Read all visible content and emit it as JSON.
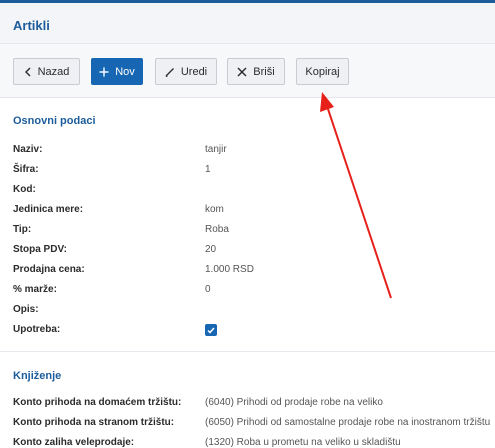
{
  "header": {
    "title": "Artikli"
  },
  "toolbar": {
    "back_label": "Nazad",
    "new_label": "Nov",
    "edit_label": "Uredi",
    "delete_label": "Briši",
    "copy_label": "Kopiraj"
  },
  "basic": {
    "title": "Osnovni podaci",
    "rows": [
      {
        "label": "Naziv:",
        "value": "tanjir"
      },
      {
        "label": "Šifra:",
        "value": "1"
      },
      {
        "label": "Kod:",
        "value": ""
      },
      {
        "label": "Jedinica mere:",
        "value": "kom"
      },
      {
        "label": "Tip:",
        "value": "Roba"
      },
      {
        "label": "Stopa PDV:",
        "value": "20"
      },
      {
        "label": "Prodajna cena:",
        "value": "1.000 RSD"
      },
      {
        "label": "% marže:",
        "value": "0"
      },
      {
        "label": "Opis:",
        "value": ""
      },
      {
        "label": "Upotreba:",
        "value": ""
      }
    ],
    "usage_checked": true
  },
  "posting": {
    "title": "Knjiženje",
    "rows": [
      {
        "label": "Konto prihoda na domaćem tržištu:",
        "value": "(6040) Prihodi od prodaje robe na veliko"
      },
      {
        "label": "Konto prihoda na stranom tržištu:",
        "value": "(6050) Prihodi od samostalne prodaje robe na inostranom tržištu"
      },
      {
        "label": "Konto zaliha veleprodaje:",
        "value": "(1320) Roba u prometu na veliko u skladištu"
      }
    ]
  },
  "colors": {
    "accent": "#1d5d9b",
    "primary_button": "#1766b3",
    "annotation_arrow": "#e8201a"
  }
}
